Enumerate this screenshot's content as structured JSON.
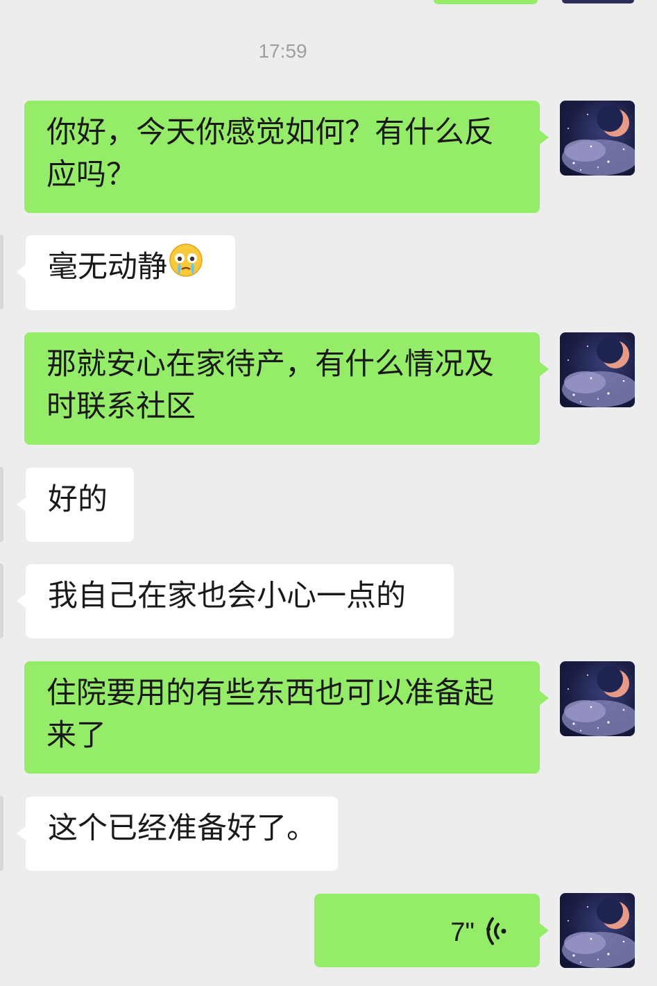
{
  "chat": {
    "timestamp": "17:59",
    "messages": [
      {
        "sender": "self",
        "text": "你好，今天你感觉如何？有什么反应吗？"
      },
      {
        "sender": "other",
        "text": "毫无动静",
        "emoji": "crying-face-emoji"
      },
      {
        "sender": "self",
        "text": "那就安心在家待产，有什么情况及时联系社区"
      },
      {
        "sender": "other",
        "text": "好的"
      },
      {
        "sender": "other",
        "text": "我自己在家也会小心一点的"
      },
      {
        "sender": "self",
        "text": "住院要用的有些东西也可以准备起来了"
      },
      {
        "sender": "other",
        "text": "这个已经准备好了。"
      },
      {
        "sender": "self",
        "type": "voice",
        "duration": "7\"",
        "icon": "voice-wave-icon"
      }
    ]
  },
  "colors": {
    "background": "#ededed",
    "outgoing_bubble": "#95ec69",
    "incoming_bubble": "#ffffff",
    "timestamp_text": "#9e9e9e"
  }
}
